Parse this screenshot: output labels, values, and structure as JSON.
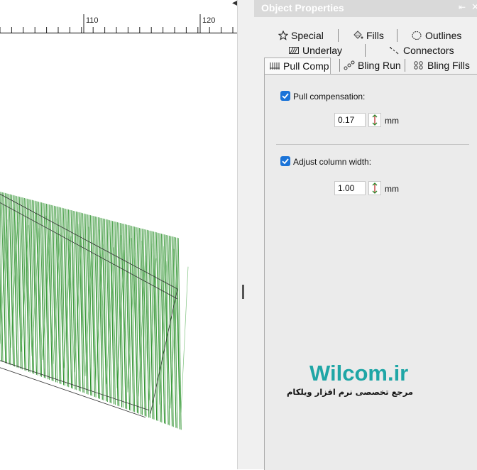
{
  "canvas": {
    "ruler_labels": [
      "110",
      "120"
    ]
  },
  "panel": {
    "title": "Object Properties",
    "tabs_row1": [
      {
        "label": "Special",
        "icon": "star-icon"
      },
      {
        "label": "Fills",
        "icon": "fill-bucket-icon"
      },
      {
        "label": "Outlines",
        "icon": "outline-icon"
      }
    ],
    "tabs_row2": [
      {
        "label": "Underlay",
        "icon": "underlay-icon"
      },
      {
        "label": "Connectors",
        "icon": "connectors-icon"
      }
    ],
    "tabs_row3": [
      {
        "label": "Pull Comp",
        "icon": "pull-comp-icon",
        "active": true
      },
      {
        "label": "Bling Run",
        "icon": "bling-run-icon"
      },
      {
        "label": "Bling Fills",
        "icon": "bling-fills-icon"
      }
    ],
    "pull_compensation": {
      "label": "Pull compensation:",
      "checked": true,
      "value": "0.17",
      "unit": "mm"
    },
    "adjust_column_width": {
      "label": "Adjust column width:",
      "checked": true,
      "value": "1.00",
      "unit": "mm"
    }
  },
  "watermark": {
    "title": "Wilcom.ir",
    "subtitle": "مرجع تخصصی نرم افزار ویلکام"
  },
  "colors": {
    "stitch_green": "#1f8a1f",
    "panel_bg": "#f0f0f0",
    "checkbox_blue": "#1a73d8",
    "watermark_teal": "#1fa6a6"
  }
}
